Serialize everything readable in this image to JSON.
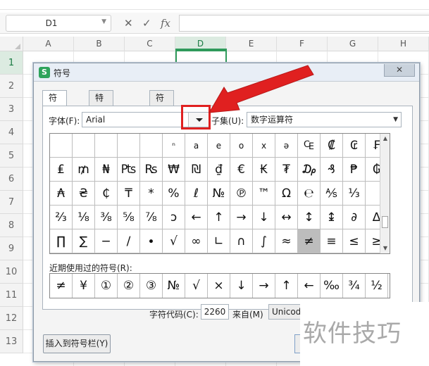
{
  "spreadsheet": {
    "namebox_value": "D1",
    "fx_label": "fx",
    "cancel_glyph": "✕",
    "confirm_glyph": "✓",
    "columns": [
      "A",
      "B",
      "C",
      "D",
      "E",
      "F",
      "G",
      "H"
    ],
    "active_column": "D",
    "rows": [
      "1",
      "2",
      "3",
      "4",
      "5",
      "6",
      "7",
      "8",
      "9",
      "10",
      "11",
      "12",
      "13"
    ],
    "active_row": "1"
  },
  "dialog": {
    "title": "符号",
    "logo_text": "S",
    "close_glyph": "✕",
    "tabs": [
      {
        "label": "符号(S)",
        "active": true
      },
      {
        "label": "特殊字符(P)",
        "active": false
      },
      {
        "label": "符号栏(T)",
        "active": false
      }
    ],
    "font_label": "字体(F):",
    "font_value": "Arial",
    "subset_label": "子集(U):",
    "subset_value": "数字运算符",
    "symbols": [
      "",
      "",
      "",
      "",
      "",
      "ⁿ",
      "a",
      "e",
      "o",
      "x",
      "ə",
      "₠",
      "₡",
      "₢",
      "₣",
      "₤",
      "₥",
      "₦",
      "₧",
      "₨",
      "₩",
      "₪",
      "₫",
      "€",
      "₭",
      "₮",
      "₯",
      "₰",
      "₱",
      "₲",
      "₳",
      "₴",
      "₵",
      "₸",
      "*",
      "%",
      "ℓ",
      "№",
      "℗",
      "™",
      "Ω",
      "℮",
      "⅍",
      "⅓",
      "",
      "⅔",
      "⅛",
      "⅜",
      "⅝",
      "⅞",
      "ↄ",
      "←",
      "↑",
      "→",
      "↓",
      "↔",
      "↕",
      "↨",
      "∂",
      "∆",
      "∏",
      "∑",
      "−",
      "∕",
      "∙",
      "√",
      "∞",
      "∟",
      "∩",
      "∫",
      "≈",
      "≠",
      "≡",
      "≤",
      "≥"
    ],
    "selected_symbol_index": 71,
    "recent_label": "近期使用过的符号(R):",
    "recent_symbols": [
      "≠",
      "¥",
      "①",
      "②",
      "③",
      "№",
      "√",
      "×",
      "↓",
      "→",
      "↑",
      "←",
      "‰",
      "¾",
      "½"
    ],
    "code_label": "字符代码(C):",
    "code_value": "2260",
    "from_label": "来自(M)",
    "from_value": "Unicod",
    "insert_button": "插入到符号栏(Y)"
  },
  "watermark": "软件技巧",
  "colors": {
    "accent_green": "#2f9a5b",
    "arrow_red": "#e02020",
    "selected_symbol_bg": "#bdbdbd"
  }
}
